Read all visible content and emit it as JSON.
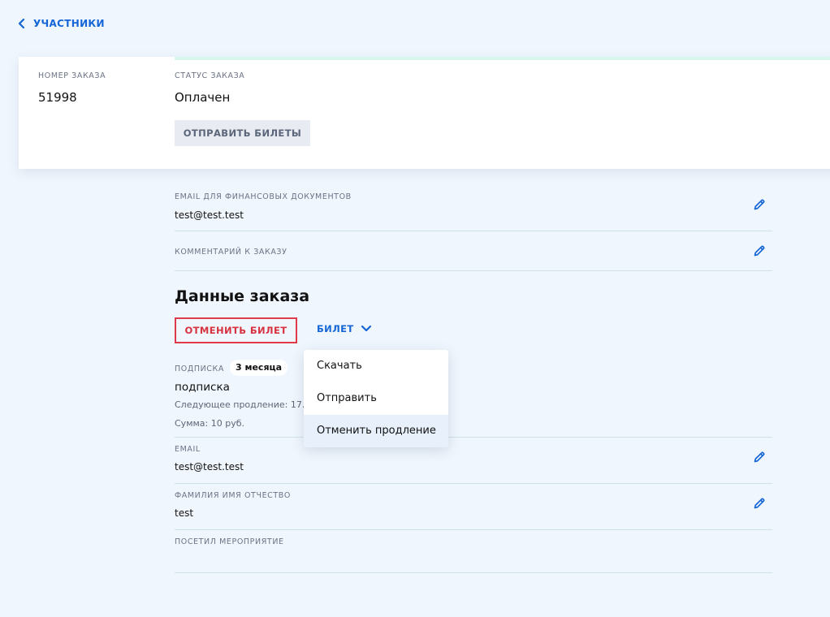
{
  "nav": {
    "back_label": "УЧАСТНИКИ"
  },
  "order": {
    "number_label": "НОМЕР ЗАКАЗА",
    "number_value": "51998",
    "status_label": "СТАТУС ЗАКАЗА",
    "status_value": "Оплачен",
    "send_tickets_label": "ОТПРАВИТЬ БИЛЕТЫ"
  },
  "fields": {
    "finance_email": {
      "label": "EMAIL ДЛЯ ФИНАНСОВЫХ ДОКУМЕНТОВ",
      "value": "test@test.test"
    },
    "comment": {
      "label": "КОММЕНТАРИЙ К ЗАКАЗУ",
      "value": ""
    }
  },
  "order_data": {
    "title": "Данные заказа",
    "cancel_ticket_label": "ОТМЕНИТЬ БИЛЕТ",
    "ticket_toggle_label": "БИЛЕТ",
    "subscription": {
      "label": "ПОДПИСКА",
      "badge": "3 месяца",
      "name": "подписка",
      "next_renewal": "Следующее продление:  17.",
      "amount": "Сумма:  10 руб."
    },
    "dropdown": {
      "items": [
        "Скачать",
        "Отправить",
        "Отменить продление"
      ]
    }
  },
  "attendee": {
    "email": {
      "label": "EMAIL",
      "value": "test@test.test"
    },
    "full_name": {
      "label": "ФАМИЛИЯ ИМЯ ОТЧЕСТВО",
      "value": "test"
    },
    "attended": {
      "label": "ПОСЕТИЛ МЕРОПРИЯТИЕ",
      "value": ""
    }
  },
  "colors": {
    "accent_blue": "#1466d6",
    "danger_red": "#e03a4a",
    "page_bg": "#f0f6fd"
  }
}
